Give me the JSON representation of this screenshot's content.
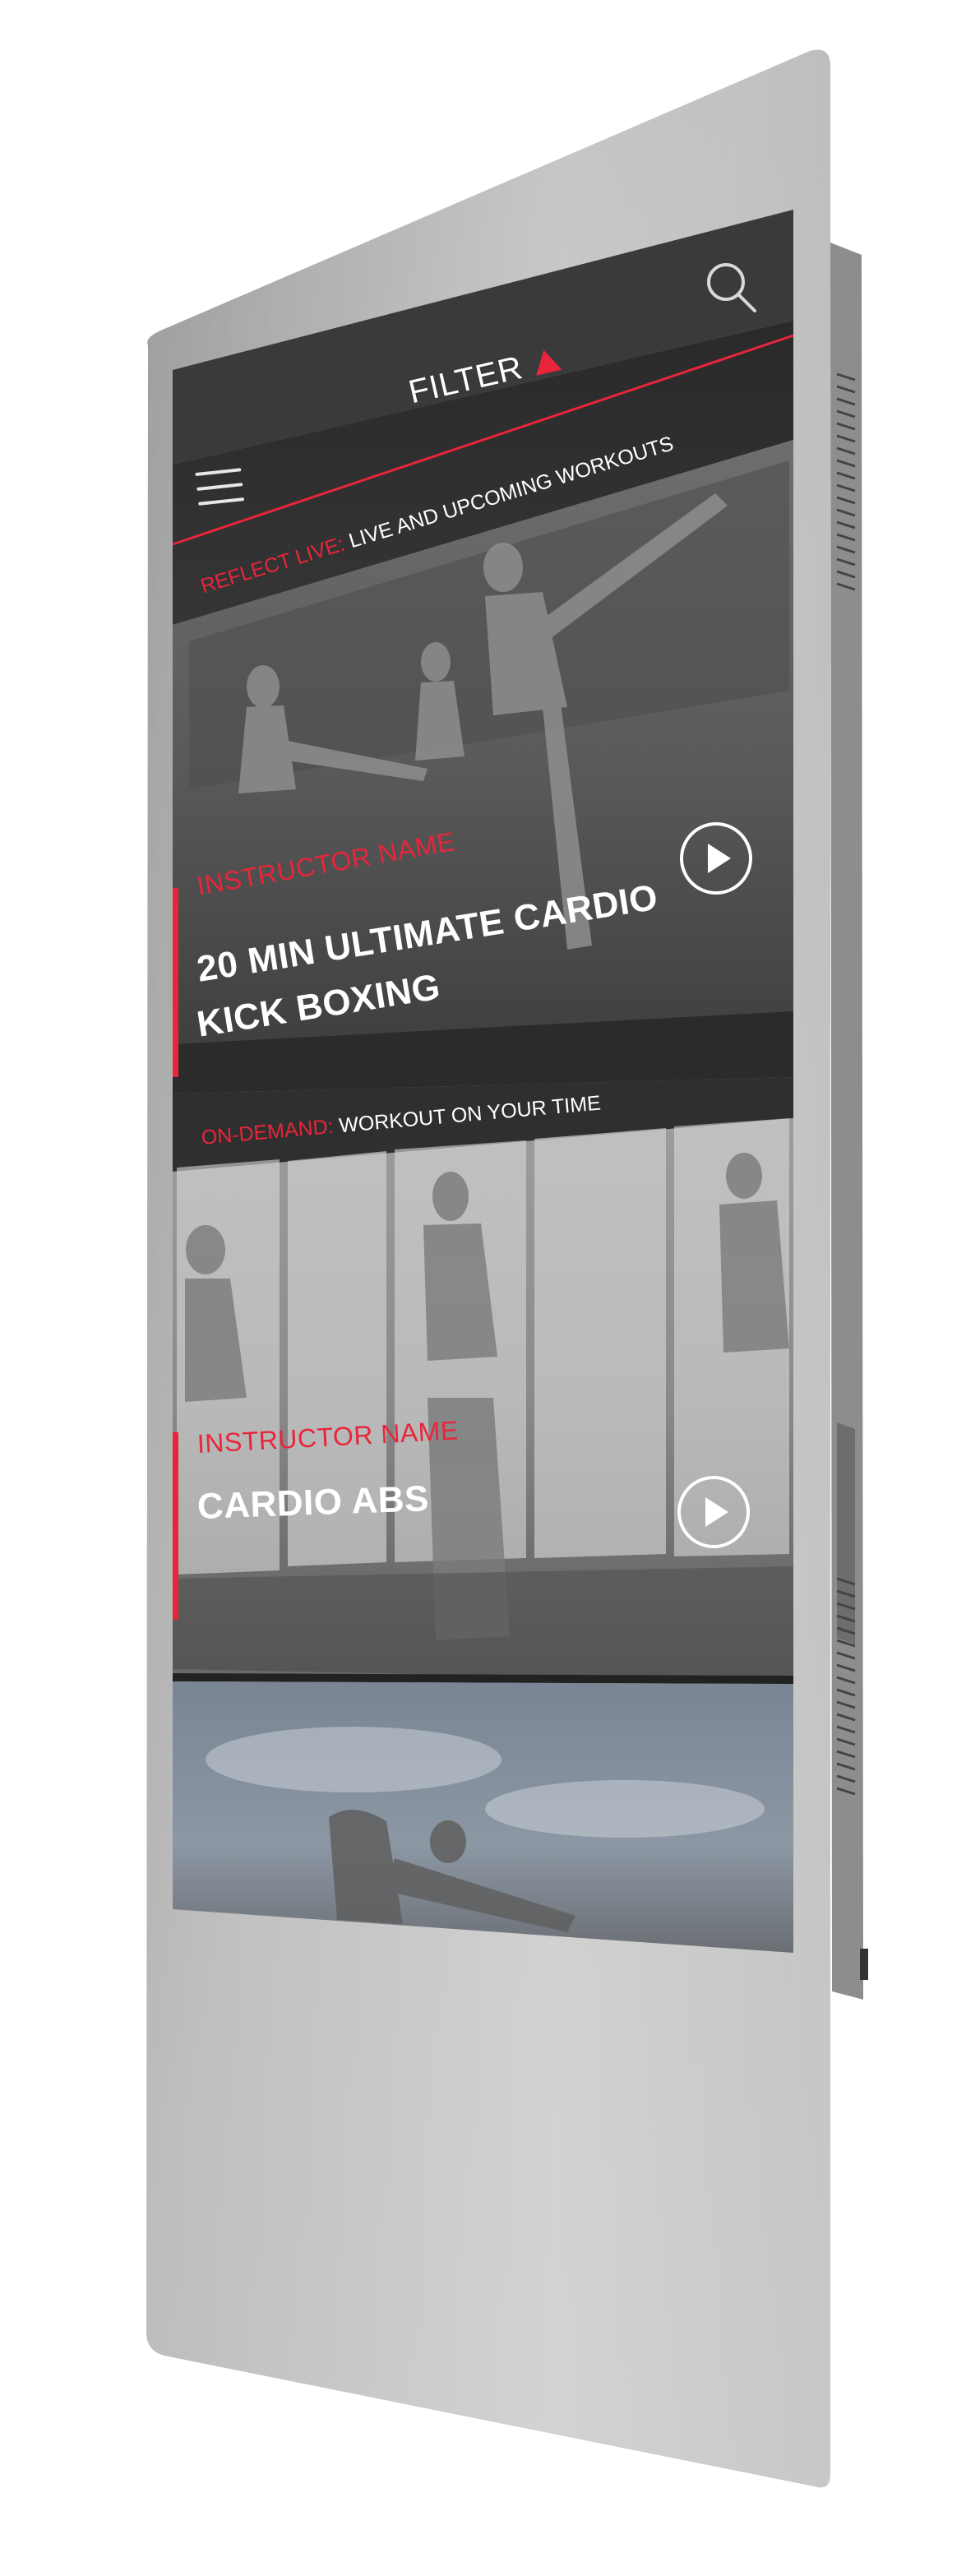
{
  "header": {
    "filter_label": "FILTER",
    "menu_icon": "hamburger-menu-icon",
    "search_icon": "search-icon"
  },
  "live_section": {
    "prefix": "REFLECT LIVE:",
    "label": "LIVE AND UPCOMING WORKOUTS"
  },
  "on_demand_section": {
    "prefix": "ON-DEMAND:",
    "label": "WORKOUT ON YOUR TIME"
  },
  "cards": [
    {
      "instructor": "INSTRUCTOR NAME",
      "title_line1": "20 MIN ULTIMATE CARDIO",
      "title_line2": "KICK BOXING",
      "action_icon": "play-icon"
    },
    {
      "instructor": "INSTRUCTOR NAME",
      "title_line1": "CARDIO ABS",
      "action_icon": "play-icon"
    }
  ],
  "colors": {
    "accent": "#e8253b",
    "device_frame": "#a9a9a9",
    "header_bar": "#2f2f2f",
    "text": "#ffffff"
  }
}
